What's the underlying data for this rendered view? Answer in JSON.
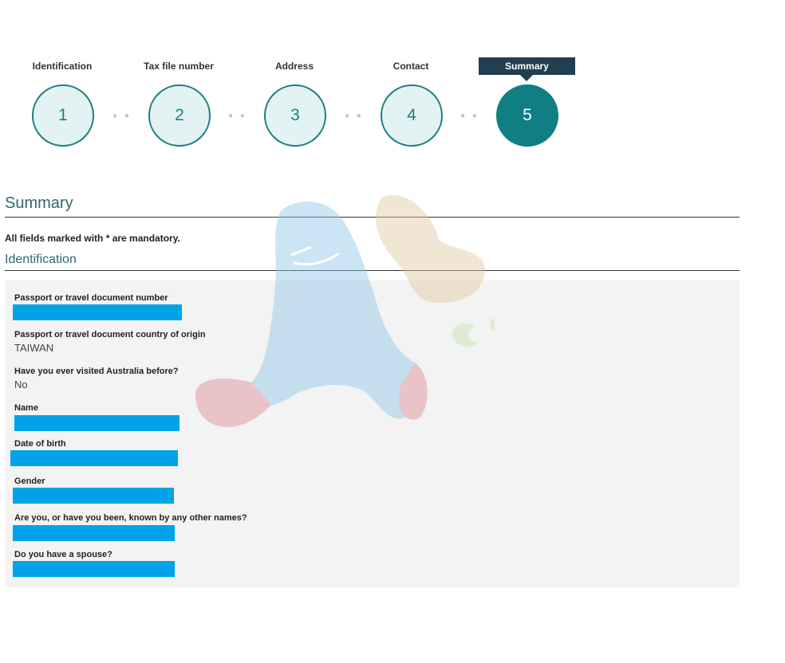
{
  "steps": [
    {
      "label": "Identification",
      "number": "1"
    },
    {
      "label": "Tax file number",
      "number": "2"
    },
    {
      "label": "Address",
      "number": "3"
    },
    {
      "label": "Contact",
      "number": "4"
    },
    {
      "label": "Summary",
      "number": "5"
    }
  ],
  "step_separator": "● ●",
  "page_title": "Summary",
  "mandatory_note": "All fields marked with * are mandatory.",
  "section_title": "Identification",
  "fields": [
    {
      "label": "Passport or travel document number",
      "value": ""
    },
    {
      "label": "Passport or travel document country of origin",
      "value": "TAIWAN"
    },
    {
      "label": "Have you ever visited Australia before?",
      "value": "No"
    },
    {
      "label": "Name",
      "value": ""
    },
    {
      "label": "Date of birth",
      "value": ""
    },
    {
      "label": "Gender",
      "value": ""
    },
    {
      "label": "Are you, or have you been, known by any other names?",
      "value": ""
    },
    {
      "label": "Do you have a spouse?",
      "value": ""
    }
  ],
  "colors": {
    "accent": "#0f7f83",
    "active_tab": "#223f50",
    "redaction": "#00a2e8"
  }
}
